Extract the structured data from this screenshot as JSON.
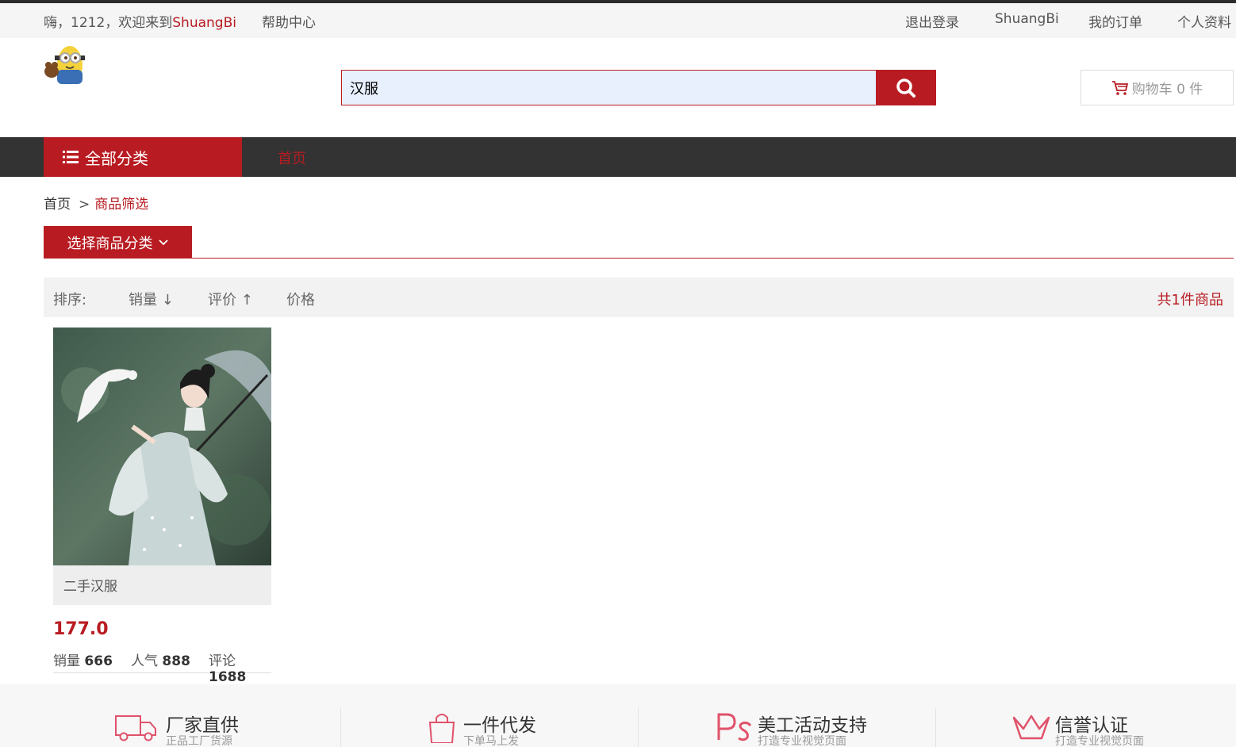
{
  "topbar": {
    "greeting": "嗨，1212，欢迎来到",
    "brand": "ShuangBi",
    "help": "帮助中心",
    "links": [
      "退出登录",
      "ShuangBi",
      "我的订单",
      "个人资料"
    ]
  },
  "search": {
    "value": "汉服"
  },
  "cart": {
    "label": "购物车 0 件"
  },
  "nav": {
    "all_categories": "全部分类",
    "home": "首页"
  },
  "breadcrumb": {
    "home": "首页",
    "sep": ">",
    "current": "商品筛选"
  },
  "category_select": "选择商品分类",
  "sort": {
    "label": "排序:",
    "sales": "销量 ↓",
    "rating": "评价 ↑",
    "price": "价格",
    "total": "共1件商品"
  },
  "products": [
    {
      "name": "二手汉服",
      "price": "177.0",
      "sales_label": "销量",
      "sales": "666",
      "popularity_label": "人气",
      "popularity": "888",
      "reviews_label": "评论",
      "reviews": "1688"
    }
  ],
  "features": [
    {
      "icon": "truck-icon",
      "title": "厂家直供",
      "subtitle": "正品工厂货源"
    },
    {
      "icon": "shopping-bag-icon",
      "title": "一件代发",
      "subtitle": "下单马上发"
    },
    {
      "icon": "photoshop-icon",
      "title": "美工活动支持",
      "subtitle": "打造专业视觉页面"
    },
    {
      "icon": "crown-icon",
      "title": "信誉认证",
      "subtitle": "打造专业视觉页面"
    }
  ],
  "colors": {
    "accent": "#b81c22",
    "nav_bg": "#333333",
    "topbar_bg": "#f5f5f5"
  }
}
